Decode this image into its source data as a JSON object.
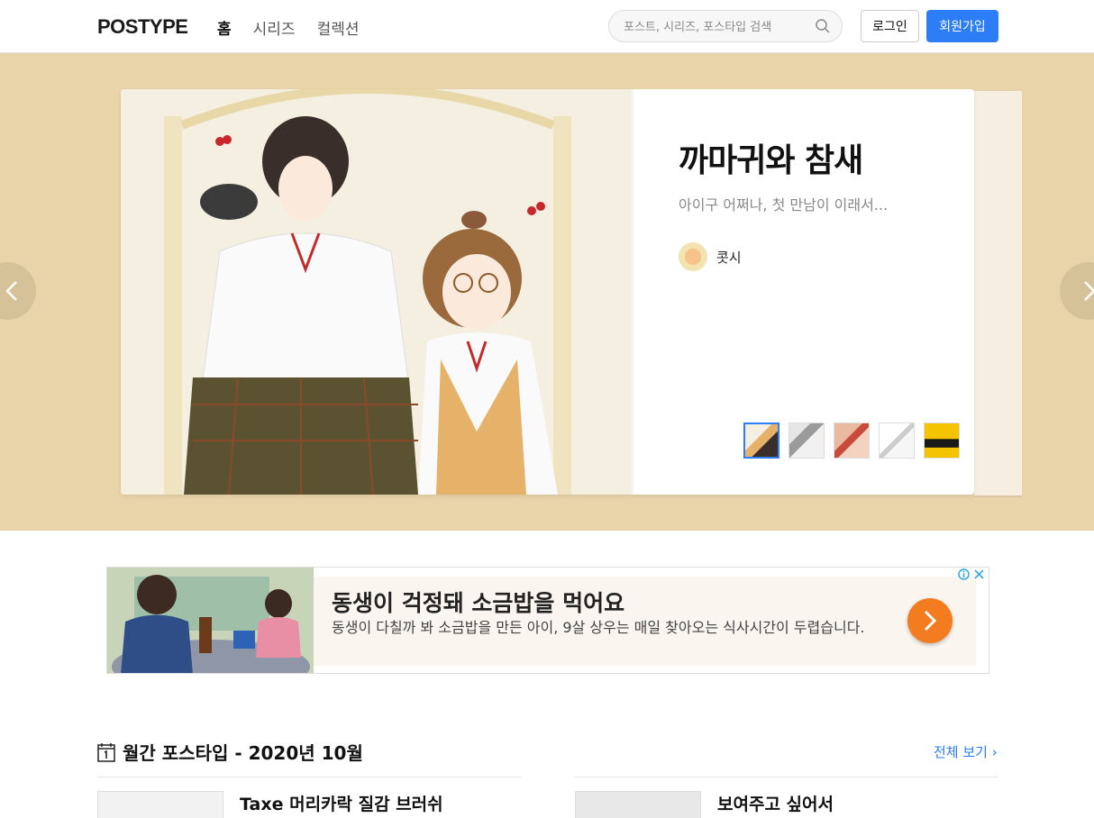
{
  "header": {
    "logo": "POSTYPE",
    "nav": [
      "홈",
      "시리즈",
      "컬렉션"
    ],
    "search_placeholder": "포스트, 시리즈, 포스타입 검색",
    "login": "로그인",
    "signup": "회원가입"
  },
  "hero": {
    "title": "까마귀와 참새",
    "subtitle": "아이구 어쩌나, 첫 만남이 이래서...",
    "author": "콧시",
    "thumbnails": [
      "thumb-1",
      "thumb-2",
      "thumb-3",
      "thumb-4",
      "thumb-5"
    ],
    "active_thumb": 0,
    "background_color": "#e9d3a9"
  },
  "ad": {
    "title": "동생이 걱정돼 소금밥을 먹어요",
    "description": "동생이 다칠까 봐 소금밥을 만든 아이, 9살 상우는 매일 찾아오는 식사시간이 두렵습니다.",
    "button_color": "#f47c20"
  },
  "monthly": {
    "title": "월간 포스타입 - 2020년 10월",
    "see_all": "전체 보기 ›",
    "posts": [
      {
        "title": "Taxe 머리카락 질감 브러쉬"
      },
      {
        "title": "보여주고 싶어서"
      }
    ]
  },
  "colors": {
    "accent": "#2d7df6"
  }
}
